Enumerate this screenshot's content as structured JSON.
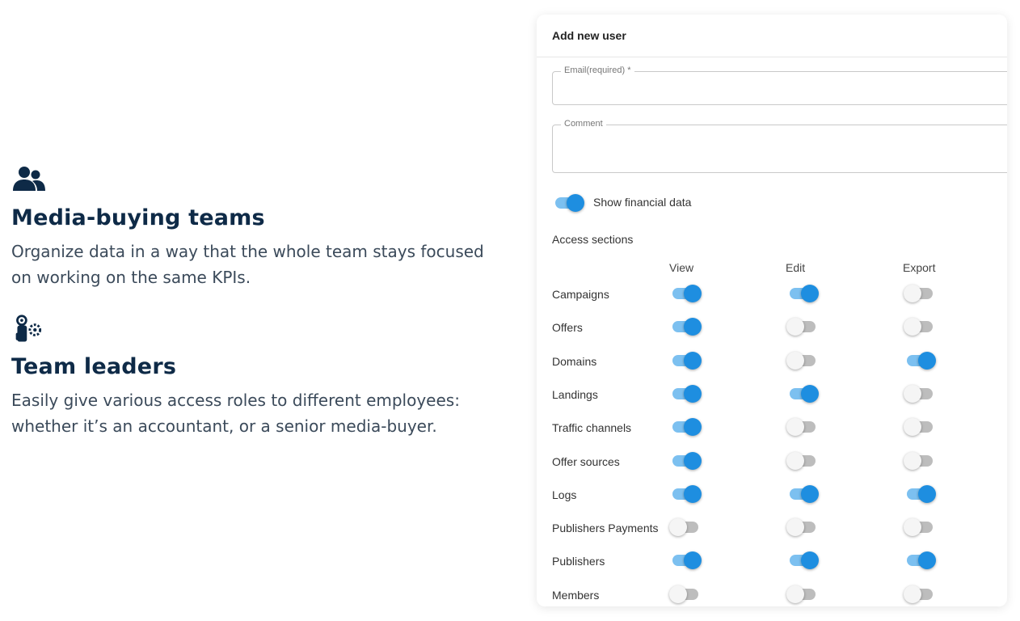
{
  "features": [
    {
      "icon": "users-icon",
      "title": "Media-buying teams",
      "description": "Organize data in a way that the whole team stays focused on working on the same KPIs."
    },
    {
      "icon": "team-leader-gear-icon",
      "title": "Team leaders",
      "description": "Easily give various access roles to different employees: whether it’s an accountant, or a senior media-buyer."
    }
  ],
  "form": {
    "title": "Add new user",
    "email_label": "Email(required) *",
    "email_value": "",
    "comment_label": "Comment",
    "comment_value": "",
    "show_financial_label": "Show financial data",
    "show_financial_on": true,
    "access_title": "Access sections",
    "columns": [
      "View",
      "Edit",
      "Export"
    ],
    "sections": [
      {
        "name": "Campaigns",
        "view": true,
        "edit": true,
        "export": false
      },
      {
        "name": "Offers",
        "view": true,
        "edit": false,
        "export": false
      },
      {
        "name": "Domains",
        "view": true,
        "edit": false,
        "export": true
      },
      {
        "name": "Landings",
        "view": true,
        "edit": true,
        "export": false
      },
      {
        "name": "Traffic channels",
        "view": true,
        "edit": false,
        "export": false
      },
      {
        "name": "Offer sources",
        "view": true,
        "edit": false,
        "export": false
      },
      {
        "name": "Logs",
        "view": true,
        "edit": true,
        "export": true
      },
      {
        "name": "Publishers Payments",
        "view": false,
        "edit": false,
        "export": false
      },
      {
        "name": "Publishers",
        "view": true,
        "edit": true,
        "export": true
      },
      {
        "name": "Members",
        "view": false,
        "edit": false,
        "export": false
      }
    ]
  },
  "colors": {
    "toggle_on": "#1e8ee0",
    "toggle_on_track": "#7cc0f0",
    "toggle_off_track": "#bdbdbd",
    "heading": "#0e2a47"
  }
}
